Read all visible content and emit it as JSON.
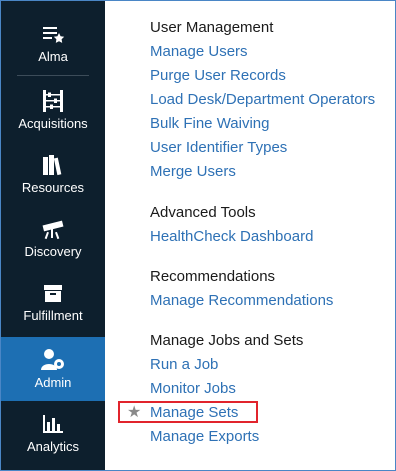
{
  "sidebar": {
    "items": [
      {
        "label": "Alma",
        "icon": "alma-menu-star-icon",
        "active": false
      },
      {
        "label": "Acquisitions",
        "icon": "abacus-icon",
        "active": false
      },
      {
        "label": "Resources",
        "icon": "books-icon",
        "active": false
      },
      {
        "label": "Discovery",
        "icon": "telescope-icon",
        "active": false
      },
      {
        "label": "Fulfillment",
        "icon": "archive-box-icon",
        "active": true
      },
      {
        "label": "Admin",
        "icon": "users-gear-icon",
        "active": true
      },
      {
        "label": "Analytics",
        "icon": "bar-chart-icon",
        "active": false
      }
    ],
    "background": "#0d1f2d",
    "active_color": "#1d6fb3"
  },
  "sections": [
    {
      "title": "User Management",
      "links": [
        "Manage Users",
        "Purge User Records",
        "Load Desk/Department Operators",
        "Bulk Fine Waiving",
        "User Identifier Types",
        "Merge Users"
      ]
    },
    {
      "title": "Advanced Tools",
      "links": [
        "HealthCheck Dashboard"
      ]
    },
    {
      "title": "Recommendations",
      "links": [
        "Manage Recommendations"
      ]
    },
    {
      "title": "Manage Jobs and Sets",
      "links": [
        "Run a Job",
        "Monitor Jobs",
        "Manage Sets",
        "Manage Exports"
      ]
    }
  ],
  "favorite_icon": "star-icon",
  "highlighted_link": "Manage Sets",
  "link_color": "#2e71b5",
  "highlight_color": "#e1242c"
}
